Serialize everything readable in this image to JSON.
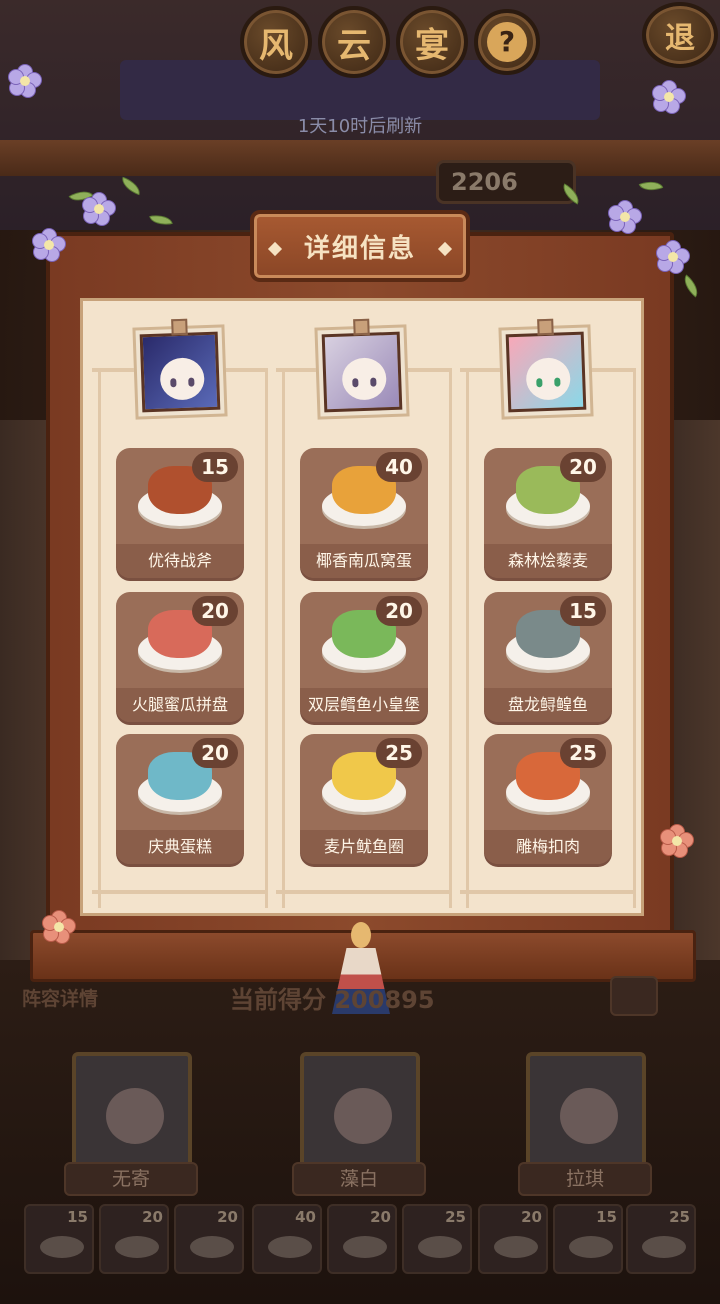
{
  "header": {
    "title_chars": [
      "风",
      "云",
      "宴"
    ],
    "help_label": "?",
    "exit_label": "退",
    "refresh_text": "1天10时后刷新",
    "top_score": "2206"
  },
  "modal": {
    "title": "详细信息",
    "columns": [
      {
        "character": "无寄",
        "dishes": [
          {
            "name": "优待战斧",
            "count": "15",
            "color": "#b0502e"
          },
          {
            "name": "火腿蜜瓜拼盘",
            "count": "20",
            "color": "#d86a5a"
          },
          {
            "name": "庆典蛋糕",
            "count": "20",
            "color": "#6fb8c8"
          }
        ]
      },
      {
        "character": "藻白",
        "dishes": [
          {
            "name": "椰香南瓜窝蛋",
            "count": "40",
            "color": "#e8a23a"
          },
          {
            "name": "双层鳕鱼小皇堡",
            "count": "20",
            "color": "#7ab85a"
          },
          {
            "name": "麦片鱿鱼圈",
            "count": "25",
            "color": "#f0c84a"
          }
        ]
      },
      {
        "character": "拉琪",
        "dishes": [
          {
            "name": "森林烩藜麦",
            "count": "20",
            "color": "#9aba5a"
          },
          {
            "name": "盘龙鲟鳇鱼",
            "count": "15",
            "color": "#7a8a8a"
          },
          {
            "name": "雕梅扣肉",
            "count": "25",
            "color": "#d8683a"
          }
        ]
      }
    ]
  },
  "lineup": {
    "label": "阵容详情",
    "score_label": "当前得分",
    "score_value": "200895",
    "members": [
      "无寄",
      "藻白",
      "拉琪"
    ]
  },
  "tray": {
    "counts": [
      "15",
      "20",
      "20",
      "40",
      "20",
      "25",
      "20",
      "15",
      "25"
    ]
  }
}
